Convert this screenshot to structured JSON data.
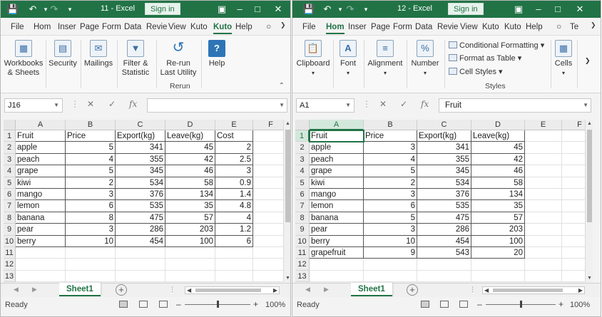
{
  "windows": [
    {
      "title": "11  -  Excel",
      "signin": "Sign in",
      "tabs": [
        "File",
        "Hom",
        "Inser",
        "Page",
        "Form",
        "Data",
        "Revie",
        "View",
        "Kuto",
        "Kuto",
        "Help"
      ],
      "active_tab_index": 9,
      "ribbon": {
        "groups": [
          {
            "label": "Workbooks\n& Sheets",
            "icon": "workbooks-icon"
          },
          {
            "label": "Security",
            "icon": "security-icon"
          },
          {
            "label": "Mailings",
            "icon": "mailings-icon"
          },
          {
            "label": "Filter &\nStatistic",
            "icon": "filter-icon"
          },
          {
            "label": "Re-run\nLast Utility",
            "icon": "rerun-icon"
          },
          {
            "label": "Help",
            "icon": "help-icon"
          }
        ],
        "group_caption": "Rerun"
      },
      "name_box": "J16",
      "formula": "",
      "columns": [
        "A",
        "B",
        "C",
        "D",
        "E",
        "F"
      ],
      "rows": [
        "1",
        "2",
        "3",
        "4",
        "5",
        "6",
        "7",
        "8",
        "9",
        "10",
        "11",
        "12",
        "13"
      ],
      "table": {
        "headers": [
          "Fruit",
          "Price",
          "Export(kg)",
          "Leave(kg)",
          "Cost"
        ],
        "data": [
          [
            "apple",
            "5",
            "341",
            "45",
            "2"
          ],
          [
            "peach",
            "4",
            "355",
            "42",
            "2.5"
          ],
          [
            "grape",
            "5",
            "345",
            "46",
            "3"
          ],
          [
            "kiwi",
            "2",
            "534",
            "58",
            "0.9"
          ],
          [
            "mango",
            "3",
            "376",
            "134",
            "1.4"
          ],
          [
            "lemon",
            "6",
            "535",
            "35",
            "4.8"
          ],
          [
            "banana",
            "8",
            "475",
            "57",
            "4"
          ],
          [
            "pear",
            "3",
            "286",
            "203",
            "1.2"
          ],
          [
            "berry",
            "10",
            "454",
            "100",
            "6"
          ]
        ]
      },
      "sheet_tab": "Sheet1",
      "status": "Ready",
      "zoom": "100%"
    },
    {
      "title": "12  -  Excel",
      "signin": "Sign in",
      "tabs": [
        "File",
        "Hom",
        "Inser",
        "Page",
        "Form",
        "Data",
        "Revie",
        "View",
        "Kuto",
        "Kuto",
        "Help",
        "Te"
      ],
      "active_tab_index": 1,
      "ribbon": {
        "groups": [
          {
            "label": "Clipboard",
            "icon": "clipboard-icon"
          },
          {
            "label": "Font",
            "icon": "font-icon"
          },
          {
            "label": "Alignment",
            "icon": "alignment-icon"
          },
          {
            "label": "Number",
            "icon": "number-icon"
          }
        ],
        "styles_items": [
          "Conditional Formatting",
          "Format as Table",
          "Cell Styles"
        ],
        "styles_caption": "Styles",
        "cells_label": "Cells"
      },
      "name_box": "A1",
      "formula": "Fruit",
      "columns": [
        "A",
        "B",
        "C",
        "D",
        "E",
        "F"
      ],
      "rows": [
        "1",
        "2",
        "3",
        "4",
        "5",
        "6",
        "7",
        "8",
        "9",
        "10",
        "11",
        "12",
        "13"
      ],
      "table": {
        "headers": [
          "Fruit",
          "Price",
          "Export(kg)",
          "Leave(kg)"
        ],
        "data": [
          [
            "apple",
            "3",
            "341",
            "45"
          ],
          [
            "peach",
            "4",
            "355",
            "42"
          ],
          [
            "grape",
            "5",
            "345",
            "46"
          ],
          [
            "kiwi",
            "2",
            "534",
            "58"
          ],
          [
            "mango",
            "3",
            "376",
            "134"
          ],
          [
            "lemon",
            "6",
            "535",
            "35"
          ],
          [
            "banana",
            "5",
            "475",
            "57"
          ],
          [
            "pear",
            "3",
            "286",
            "203"
          ],
          [
            "berry",
            "10",
            "454",
            "100"
          ],
          [
            "grapefruit",
            "9",
            "543",
            "20"
          ]
        ]
      },
      "sheet_tab": "Sheet1",
      "status": "Ready",
      "zoom": "100%"
    }
  ],
  "colors": {
    "excel_green": "#217346",
    "ribbon_bg": "#f8f8f8",
    "grid_line": "#e1e1e1"
  }
}
